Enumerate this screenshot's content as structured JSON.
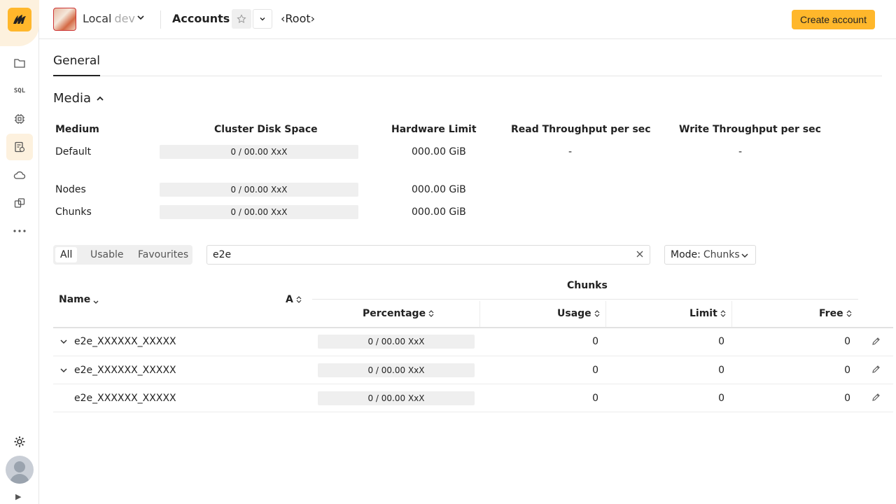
{
  "sidebar": {
    "items": [
      {
        "name": "folder-icon"
      },
      {
        "name": "sql-icon",
        "label": "SQL"
      },
      {
        "name": "cpu-icon"
      },
      {
        "name": "accounts-icon"
      },
      {
        "name": "cloud-icon"
      },
      {
        "name": "packages-icon"
      },
      {
        "name": "more-icon"
      }
    ],
    "active_index": 3
  },
  "header": {
    "db_name": "Local",
    "db_env": "dev",
    "page_title": "Accounts",
    "breadcrumb": "‹Root›",
    "create_button": "Create account"
  },
  "tabs": [
    {
      "label": "General",
      "active": true
    }
  ],
  "media": {
    "title": "Media",
    "columns": [
      "Medium",
      "Cluster Disk Space",
      "Hardware Limit",
      "Read Throughput per sec",
      "Write Throughput per sec"
    ],
    "rows": [
      {
        "medium": "Default",
        "disk": "0 / 00.00 XxX",
        "limit": "000.00 GiB",
        "read": "-",
        "write": "-"
      },
      {
        "medium": "Nodes",
        "disk": "0 / 00.00 XxX",
        "limit": "000.00 GiB",
        "read": "",
        "write": ""
      },
      {
        "medium": "Chunks",
        "disk": "0 / 00.00 XxX",
        "limit": "000.00 GiB",
        "read": "",
        "write": ""
      }
    ]
  },
  "filters": {
    "segments": [
      "All",
      "Usable",
      "Favourites"
    ],
    "active_segment": "All",
    "search_value": "e2e",
    "mode_label": "Mode:",
    "mode_value": "Chunks"
  },
  "table": {
    "group_header": "Chunks",
    "columns": {
      "name": "Name",
      "a": "A",
      "percentage": "Percentage",
      "usage": "Usage",
      "limit": "Limit",
      "free": "Free"
    },
    "rows": [
      {
        "name": "e2e_XXXXXX_XXXXX",
        "expandable": true,
        "percentage": "0 / 00.00 XxX",
        "usage": "0",
        "limit": "0",
        "free": "0"
      },
      {
        "name": "e2e_XXXXXX_XXXXX",
        "expandable": true,
        "percentage": "0 / 00.00 XxX",
        "usage": "0",
        "limit": "0",
        "free": "0"
      },
      {
        "name": "e2e_XXXXXX_XXXXX",
        "expandable": false,
        "percentage": "0 / 00.00 XxX",
        "usage": "0",
        "limit": "0",
        "free": "0"
      }
    ]
  },
  "colors": {
    "accent": "#ffb72b",
    "accent_light": "#fdf1de"
  }
}
